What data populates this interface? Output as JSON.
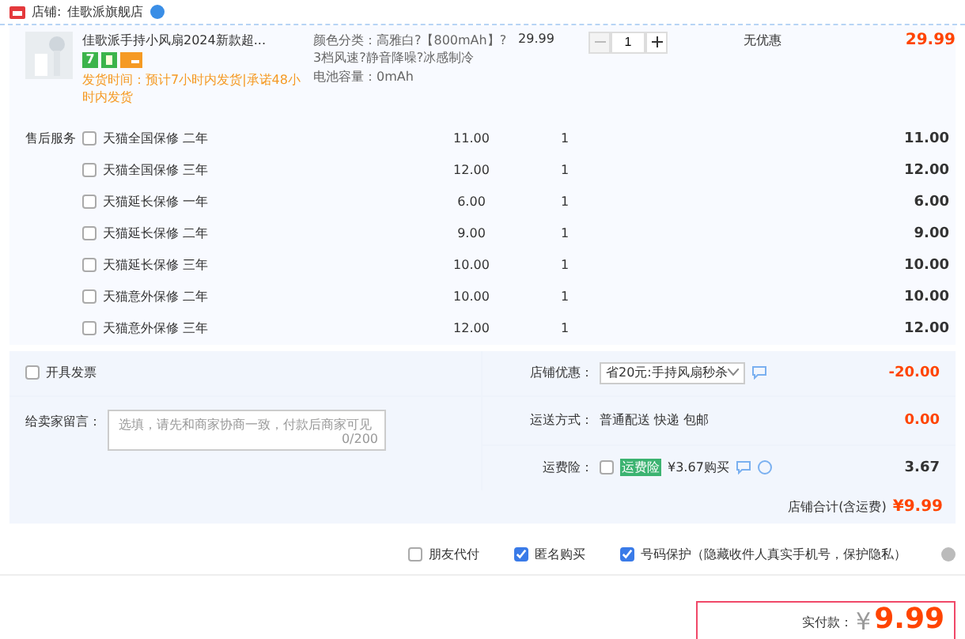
{
  "shop": {
    "label": "店铺:",
    "name": "佳歌派旗舰店"
  },
  "item": {
    "title": "佳歌派手持小风扇2024新款超...",
    "badge": "7",
    "shipping": "发货时间：预计7小时内发货|承诺48小时内发货",
    "specs": [
      "颜色分类：高雅白?【800mAh】?3档风速?静音降噪?冰感制冷",
      "电池容量：0mAh"
    ],
    "price": "29.99",
    "quantity": "1",
    "discount": "无优惠",
    "total": "29.99"
  },
  "services": {
    "label": "售后服务",
    "rows": [
      {
        "name": "天猫全国保修 二年",
        "price": "11.00",
        "quantity": "1",
        "total": "11.00",
        "checked": false
      },
      {
        "name": "天猫全国保修 三年",
        "price": "12.00",
        "quantity": "1",
        "total": "12.00",
        "checked": false
      },
      {
        "name": "天猫延长保修 一年",
        "price": "6.00",
        "quantity": "1",
        "total": "6.00",
        "checked": false
      },
      {
        "name": "天猫延长保修 二年",
        "price": "9.00",
        "quantity": "1",
        "total": "9.00",
        "checked": false
      },
      {
        "name": "天猫延长保修 三年",
        "price": "10.00",
        "quantity": "1",
        "total": "10.00",
        "checked": false
      },
      {
        "name": "天猫意外保修 二年",
        "price": "10.00",
        "quantity": "1",
        "total": "10.00",
        "checked": false
      },
      {
        "name": "天猫意外保修 三年",
        "price": "12.00",
        "quantity": "1",
        "total": "12.00",
        "checked": false
      }
    ]
  },
  "invoice": {
    "label": "开具发票",
    "checked": false
  },
  "message": {
    "label": "给卖家留言：",
    "placeholder": "选填，请先和商家协商一致，付款后商家可见",
    "count": "0/200"
  },
  "coupon": {
    "label": "店铺优惠：",
    "value": "省20元:手持风扇秒杀",
    "amount": "-20.00"
  },
  "delivery": {
    "label": "运送方式：",
    "value": "普通配送 快递 包邮",
    "amount": "0.00"
  },
  "insurance": {
    "label": "运费险：",
    "checked": false,
    "tag": "运费险",
    "price": "¥3.67购买",
    "amount": "3.67"
  },
  "subtotal": {
    "label": "店铺合计(含运费)",
    "amount": "¥9.99"
  },
  "options": [
    {
      "label": "朋友代付",
      "checked": false
    },
    {
      "label": "匿名购买",
      "checked": true
    },
    {
      "label": "号码保护（隐藏收件人真实手机号，保护隐私）",
      "checked": true
    }
  ],
  "payment": {
    "label": "实付款：",
    "currency": "¥",
    "amount": "9.99"
  }
}
